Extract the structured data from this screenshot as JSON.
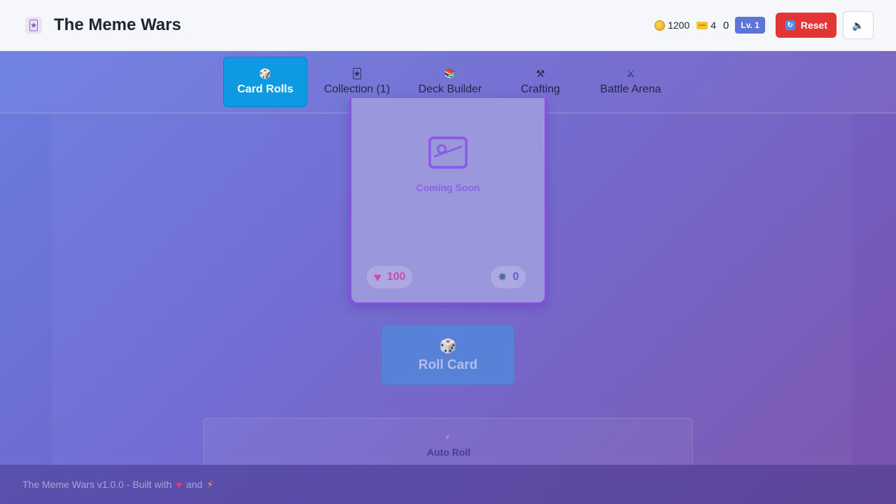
{
  "header": {
    "app_title": "The Meme Wars",
    "coins": "1200",
    "tickets": "4",
    "gems": "0",
    "level": "Lv. 1",
    "reset_label": "Reset"
  },
  "tabs": [
    {
      "label": "Card Rolls",
      "icon": "dice-icon",
      "active": true
    },
    {
      "label": "Collection (1)",
      "icon": "cards-icon",
      "active": false
    },
    {
      "label": "Deck Builder",
      "icon": "books-icon",
      "active": false
    },
    {
      "label": "Crafting",
      "icon": "tools-icon",
      "active": false
    },
    {
      "label": "Battle Arena",
      "icon": "swords-icon",
      "active": false
    }
  ],
  "card": {
    "placeholder_text": "Coming Soon",
    "hp": "100",
    "attack": "0"
  },
  "roll": {
    "button_label": "Roll Card"
  },
  "auto_roll": {
    "label": "Auto Roll"
  },
  "footer": {
    "text_before": "The Meme Wars v1.0.0 - Built with",
    "text_middle": "and"
  },
  "colors": {
    "active_tab": "#0e9ae3",
    "reset_button": "#e23535",
    "level_badge": "#5d74d8",
    "card_border": "#8a4fe0"
  }
}
